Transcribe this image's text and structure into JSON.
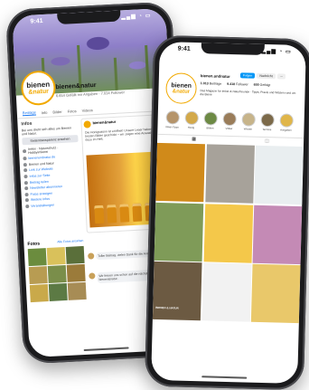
{
  "back_phone": {
    "status_time": "9:41",
    "page": {
      "logo_line1": "bienen",
      "logo_line2": "&natur",
      "name": "bienen&natur",
      "subtitle": "6.654 Gefällt mir Angaben · 7.034 Follower"
    },
    "tabs": [
      "Beiträge",
      "Info",
      "Bilder",
      "Fotos",
      "Videos"
    ],
    "intro": {
      "heading": "Infos",
      "description": "Bei uns dreht sich alles um Bienen und Natur.",
      "button": "Seitentransparenz ansehen",
      "items": [
        "Imker · Naturschutz · Hobbyimkerei",
        "bienenundnatur.de",
        "Bienen und Natur",
        "Link zur Website",
        "Infos zur Seite",
        "Beitrag teilen",
        "Newsletter abonnieren",
        "Fotos anzeigen",
        "Weitere Infos",
        "Veranstaltungen"
      ]
    },
    "post": {
      "author": "bienen&natur",
      "text": "Die Honigsaison ist eröffnet! Unsere Leser haben ihre besten Bilder geschickt – wir zeigen eine Auswahl. Mehr dazu im Heft."
    },
    "photos": {
      "heading": "Fotos",
      "all_label": "Alle Fotos ansehen",
      "tiles": [
        "#6b8c3e",
        "#d9c15b",
        "#5a6f3a",
        "#b89c52",
        "#7a8e4a",
        "#9b7b3a",
        "#c9a94a",
        "#5c7a44",
        "#a78c55"
      ]
    },
    "comments": [
      "Toller Beitrag, vielen Dank für die Anregungen!",
      "Wir freuen uns schon auf die nächste Ausgabe von bienen&natur."
    ]
  },
  "front_phone": {
    "status_time": "9:41",
    "profile": {
      "logo_line1": "bienen",
      "logo_line2": "&natur",
      "username": "bienen.undnatur",
      "follow_button": "Folgen",
      "message_button": "Nachricht",
      "stats": [
        {
          "value": "1.013",
          "label": "Beiträge"
        },
        {
          "value": "9.418",
          "label": "Follower"
        },
        {
          "value": "600",
          "label": "Gefolgt"
        }
      ],
      "bio": "Das Magazin für Imker & Naturfreunde · Tipps, Praxis und Wissen rund um die Biene"
    },
    "highlights": [
      "Imker-Tipps",
      "Honig",
      "Blüten",
      "Völker",
      "Wissen",
      "Termine",
      "Ausgaben"
    ],
    "highlight_colors": [
      "#b5946a",
      "#d3a94a",
      "#6d8a45",
      "#9a7d5a",
      "#c7b48a",
      "#7c6a4a",
      "#e0b64a"
    ],
    "tabs": [
      "grid-icon",
      "tagged-icon"
    ],
    "grid_tiles": [
      "#d08a1a",
      "#a7a29a",
      "#e9eef0",
      "#7f9b58",
      "#f4c84a",
      "#c48ab5",
      "#6c5a42",
      "#f2f2f2",
      "#e9c86a"
    ],
    "grid_caption": "BIENEN & NATUR"
  }
}
